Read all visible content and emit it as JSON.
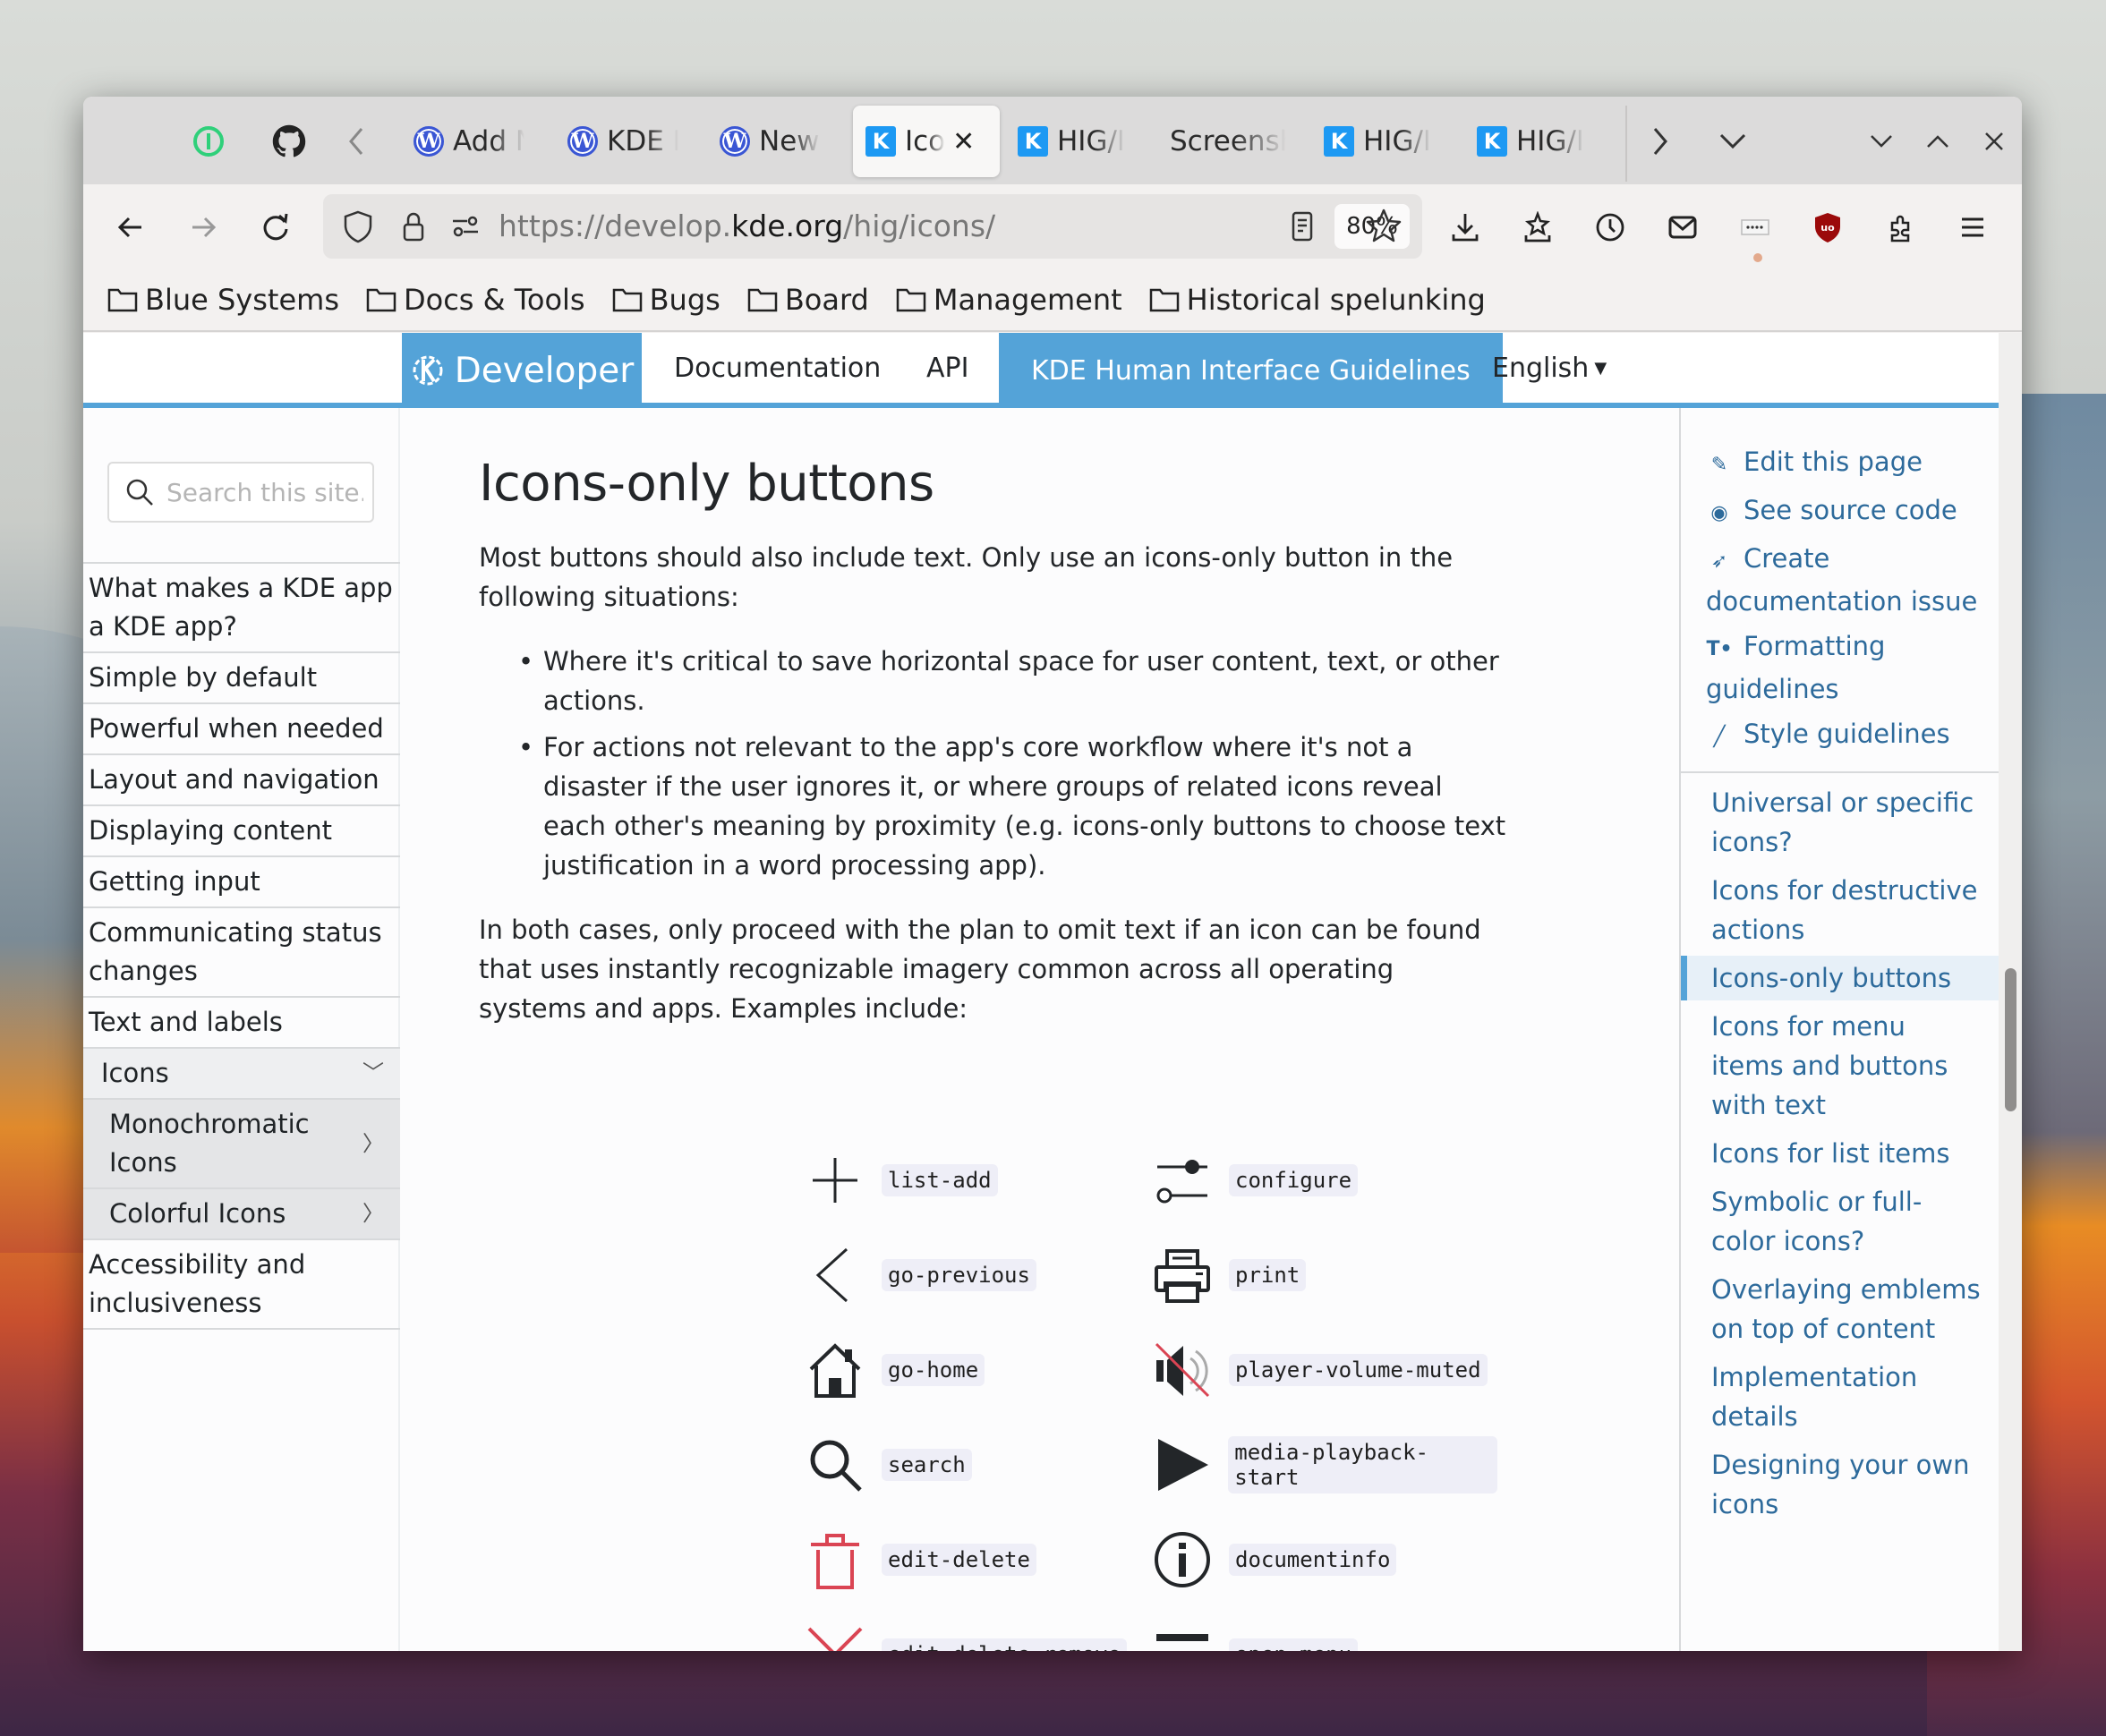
{
  "browser": {
    "pinned_tabs": [
      {
        "name": "1password",
        "icon": "1password-icon"
      },
      {
        "name": "github",
        "icon": "github-icon"
      }
    ],
    "tabs": [
      {
        "label": "Add N",
        "favicon": "wordpress-icon"
      },
      {
        "label": "KDE H",
        "favicon": "wordpress-icon"
      },
      {
        "label": "New",
        "favicon": "wordpress-icon"
      },
      {
        "label": "Ico",
        "favicon": "kde-icon",
        "active": true
      },
      {
        "label": "HIG/I",
        "favicon": "kde-icon"
      },
      {
        "label": "Screensh",
        "favicon": ""
      },
      {
        "label": "HIG/I",
        "favicon": "kde-icon"
      },
      {
        "label": "HIG/I",
        "favicon": "kde-icon"
      }
    ],
    "url": {
      "prefix": "https://develop.",
      "domain": "kde.org",
      "path": "/hig/icons/"
    },
    "zoom_level": "80%",
    "bookmarks": [
      "Blue Systems",
      "Docs & Tools",
      "Bugs",
      "Board",
      "Management",
      "Historical spelunking"
    ]
  },
  "site": {
    "brand": "Developer",
    "nav": [
      {
        "label": "Documentation",
        "active": false
      },
      {
        "label": "API",
        "active": false
      },
      {
        "label": "KDE Human Interface Guidelines",
        "active": true
      }
    ],
    "language": "English",
    "search_placeholder": "Search this site..."
  },
  "leftnav": [
    {
      "label": "What makes a KDE app a KDE app?",
      "type": "item"
    },
    {
      "label": "Simple by default",
      "type": "item"
    },
    {
      "label": "Powerful when needed",
      "type": "item"
    },
    {
      "label": "Layout and navigation",
      "type": "item"
    },
    {
      "label": "Displaying content",
      "type": "item"
    },
    {
      "label": "Getting input",
      "type": "item"
    },
    {
      "label": "Communicating status changes",
      "type": "item"
    },
    {
      "label": "Text and labels",
      "type": "item"
    },
    {
      "label": "Icons",
      "type": "section",
      "expanded": true
    },
    {
      "label": "Monochromatic Icons",
      "type": "sub"
    },
    {
      "label": "Colorful Icons",
      "type": "sub"
    },
    {
      "label": "Accessibility and inclusiveness",
      "type": "item"
    }
  ],
  "article": {
    "title": "Icons-only buttons",
    "intro": "Most buttons should also include text. Only use an icons-only button in the following situations:",
    "bullets": [
      "Where it's critical to save horizontal space for user content, text, or other actions.",
      "For actions not relevant to the app's core workflow where it's not a disaster if the user ignores it, or where groups of related icons reveal each other's meaning by proximity (e.g. icons-only buttons to choose text justification in a word processing app)."
    ],
    "outro": "In both cases, only proceed with the plan to omit text if an icon can be found that uses instantly recognizable imagery common across all operating systems and apps. Examples include:",
    "icon_examples": [
      {
        "name": "list-add",
        "icon": "plus-icon"
      },
      {
        "name": "configure",
        "icon": "sliders-icon"
      },
      {
        "name": "go-previous",
        "icon": "chevron-left-icon"
      },
      {
        "name": "print",
        "icon": "printer-icon"
      },
      {
        "name": "go-home",
        "icon": "home-icon"
      },
      {
        "name": "player-volume-muted",
        "icon": "volume-muted-icon"
      },
      {
        "name": "search",
        "icon": "search-icon"
      },
      {
        "name": "media-playback-start",
        "icon": "play-icon"
      },
      {
        "name": "edit-delete",
        "icon": "trash-icon"
      },
      {
        "name": "documentinfo",
        "icon": "info-icon"
      },
      {
        "name": "edit-delete-remove",
        "icon": "x-icon"
      },
      {
        "name": "open-menu",
        "icon": "hamburger-icon"
      }
    ]
  },
  "rightnav": {
    "edit_links": [
      {
        "label": "Edit this page",
        "icon": "pencil-icon"
      },
      {
        "label": "See source code",
        "icon": "eye-icon"
      },
      {
        "label": "Create documentation issue",
        "icon": "paper-plane-icon"
      },
      {
        "label": "Formatting guidelines",
        "icon": "text-format-icon"
      },
      {
        "label": "Style guidelines",
        "icon": "brush-icon"
      }
    ],
    "toc": [
      {
        "label": "Universal or specific icons?",
        "active": false
      },
      {
        "label": "Icons for destructive actions",
        "active": false
      },
      {
        "label": "Icons-only buttons",
        "active": true
      },
      {
        "label": "Icons for menu items and buttons with text",
        "active": false
      },
      {
        "label": "Icons for list items",
        "active": false
      },
      {
        "label": "Symbolic or full-color icons?",
        "active": false
      },
      {
        "label": "Overlaying emblems on top of content",
        "active": false
      },
      {
        "label": "Implementation details",
        "active": false
      },
      {
        "label": "Designing your own icons",
        "active": false
      }
    ]
  },
  "colors": {
    "kde_blue": "#54a3d8",
    "link": "#2d6a9b",
    "destructive_red": "#da4453"
  }
}
